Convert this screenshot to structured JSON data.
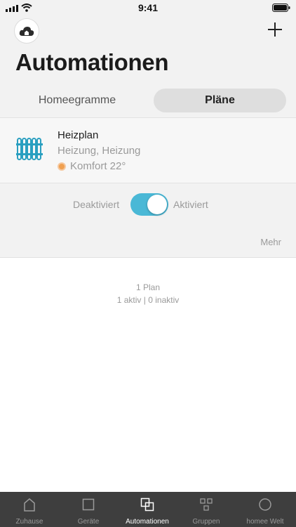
{
  "status_bar": {
    "time": "9:41"
  },
  "header": {
    "title": "Automationen"
  },
  "segments": [
    {
      "label": "Homeegramme"
    },
    {
      "label": "Pläne"
    }
  ],
  "plan": {
    "name": "Heizplan",
    "subtitle": "Heizung, Heizung",
    "mode": "Komfort 22°",
    "toggle": {
      "off_label": "Deaktiviert",
      "on_label": "Aktiviert",
      "active": true
    },
    "more_label": "Mehr"
  },
  "summary": {
    "count": "1 Plan",
    "status": "1 aktiv | 0 inaktiv"
  },
  "tab_bar": {
    "tabs": [
      {
        "label": "Zuhause",
        "icon": "house-icon"
      },
      {
        "label": "Geräte",
        "icon": "square-icon"
      },
      {
        "label": "Automationen",
        "icon": "overlapping-squares-icon"
      },
      {
        "label": "Gruppen",
        "icon": "grid-icon"
      },
      {
        "label": "homee Welt",
        "icon": "circle-icon"
      }
    ],
    "active_index": 2
  },
  "colors": {
    "accent": "#4ab8d6",
    "tab_bar": "#3e3e3e",
    "mode_dot": "#f0a050"
  }
}
